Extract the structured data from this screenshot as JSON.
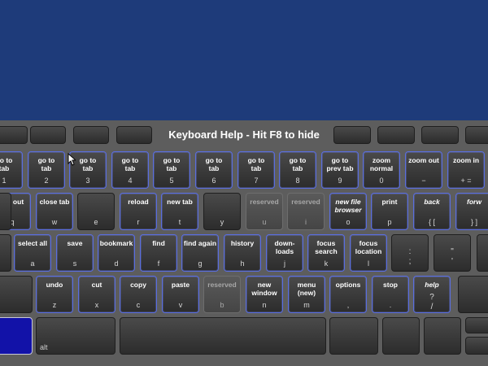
{
  "header": {
    "title": "Keyboard Help - Hit F8 to hide"
  },
  "rows": [
    [
      {
        "desc": "go to\ntab",
        "ch": "1"
      },
      {
        "desc": "go to\ntab",
        "ch": "2"
      },
      {
        "desc": "go to\ntab",
        "ch": "3"
      },
      {
        "desc": "go to\ntab",
        "ch": "4"
      },
      {
        "desc": "go to\ntab",
        "ch": "5"
      },
      {
        "desc": "go to\ntab",
        "ch": "6"
      },
      {
        "desc": "go to\ntab",
        "ch": "7"
      },
      {
        "desc": "go to\ntab",
        "ch": "8"
      },
      {
        "desc": "go to\nprev tab",
        "ch": "9"
      },
      {
        "desc": "zoom\nnormal",
        "ch": "0"
      },
      {
        "desc": "zoom out",
        "ch": "−"
      },
      {
        "desc": "zoom in",
        "ch": "+ ="
      }
    ],
    [
      {
        "desc": "log out",
        "ch": "q"
      },
      {
        "desc": "close tab",
        "ch": "w"
      },
      {
        "desc": "",
        "ch": "e"
      },
      {
        "desc": "reload",
        "ch": "r"
      },
      {
        "desc": "new tab",
        "ch": "t"
      },
      {
        "desc": "",
        "ch": "y"
      },
      {
        "desc": "reserved",
        "ch": "u"
      },
      {
        "desc": "reserved",
        "ch": "i"
      },
      {
        "desc": "new file\nbrowser",
        "ch": "o"
      },
      {
        "desc": "print",
        "ch": "p"
      },
      {
        "desc": "back",
        "ch": "{ ["
      },
      {
        "desc": "forw",
        "ch": "} ]"
      }
    ],
    [
      {
        "desc": "select all",
        "ch": "a"
      },
      {
        "desc": "save",
        "ch": "s"
      },
      {
        "desc": "bookmark",
        "ch": "d"
      },
      {
        "desc": "find",
        "ch": "f"
      },
      {
        "desc": "find again",
        "ch": "g"
      },
      {
        "desc": "history",
        "ch": "h"
      },
      {
        "desc": "down-\nloads",
        "ch": "j"
      },
      {
        "desc": "focus\nsearch",
        "ch": "k"
      },
      {
        "desc": "focus\nlocation",
        "ch": "l"
      },
      {
        "desc": "",
        "sym": ":\n;"
      },
      {
        "desc": "",
        "sym": "\"\n'"
      }
    ],
    [
      {
        "desc": "undo",
        "ch": "z"
      },
      {
        "desc": "cut",
        "ch": "x"
      },
      {
        "desc": "copy",
        "ch": "c"
      },
      {
        "desc": "paste",
        "ch": "v"
      },
      {
        "desc": "reserved",
        "ch": "b"
      },
      {
        "desc": "new\nwindow",
        "ch": "n"
      },
      {
        "desc": "menu\n(new)",
        "ch": "m"
      },
      {
        "desc": "options",
        "ch": ","
      },
      {
        "desc": "stop",
        "ch": "."
      },
      {
        "desc": "help",
        "sym": "?\n/"
      }
    ]
  ],
  "bottom_row": {
    "alt_label": "alt"
  }
}
